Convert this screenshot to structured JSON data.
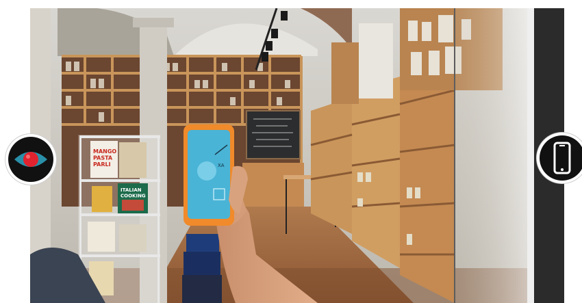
{
  "scene": {
    "books": {
      "mango_title": "MANGO\nPASTA\nPARLI",
      "cooking_title": "ITALIAN\nCOOKING"
    },
    "blackboard": {
      "lines": [
        "....",
        "....."
      ]
    }
  },
  "overlay_buttons": {
    "left": {
      "icon": "eye-icon",
      "accent": "#e0232e",
      "ring": "#2a8fa8"
    },
    "right": {
      "icon": "smartphone-icon"
    }
  },
  "colors": {
    "shelf_wood": "#c9955a",
    "phone_screen": "#4ab4d6",
    "phone_case": "#f08a2a"
  }
}
